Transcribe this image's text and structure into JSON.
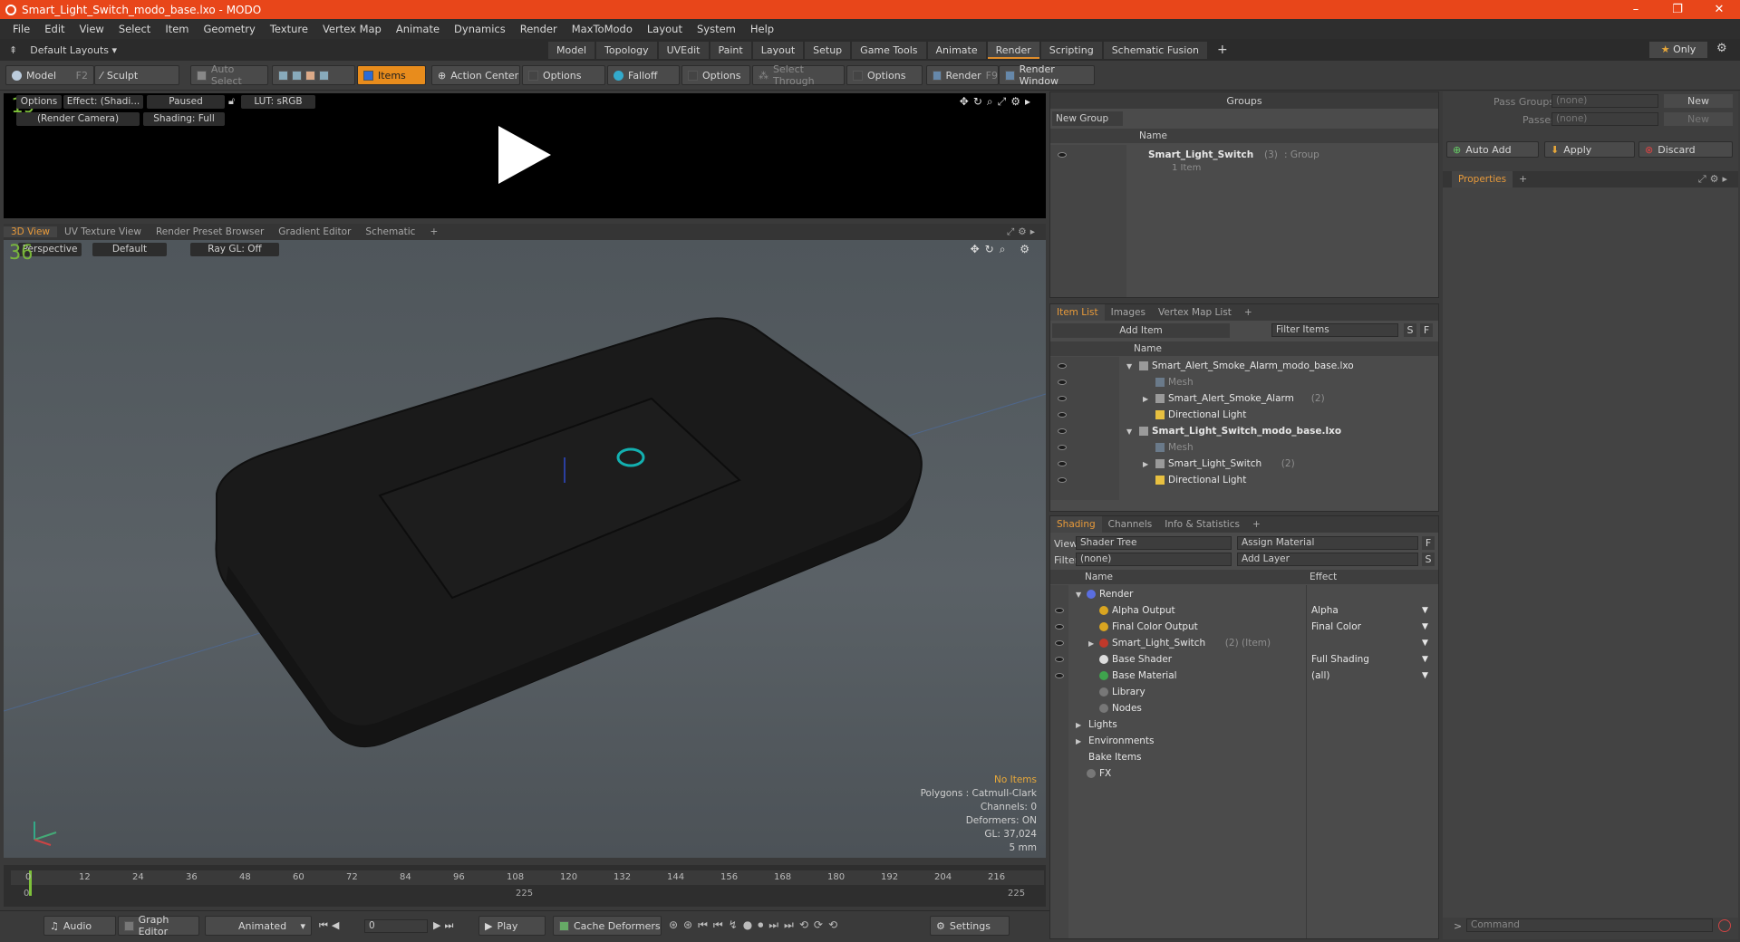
{
  "window": {
    "title": "Smart_Light_Switch_modo_base.lxo - MODO",
    "minimize": "–",
    "maximize": "❐",
    "close": "✕"
  },
  "menu": [
    "File",
    "Edit",
    "View",
    "Select",
    "Item",
    "Geometry",
    "Texture",
    "Vertex Map",
    "Animate",
    "Dynamics",
    "Render",
    "MaxToModo",
    "Layout",
    "System",
    "Help"
  ],
  "layout": {
    "label": "Default Layouts",
    "tabs": [
      "Model",
      "Topology",
      "UVEdit",
      "Paint",
      "Layout",
      "Setup",
      "Game Tools",
      "Animate",
      "Render",
      "Scripting",
      "Schematic Fusion"
    ],
    "active_tab": "Render",
    "add": "+",
    "only": "Only"
  },
  "toolbar": {
    "model": "Model",
    "model_key": "F2",
    "sculpt": "Sculpt",
    "auto_select": "Auto Select",
    "items": "Items",
    "action_center": "Action Center",
    "options1": "Options",
    "falloff": "Falloff",
    "options2": "Options",
    "select_through": "Select Through",
    "options3": "Options",
    "render": "Render",
    "render_key": "F9",
    "render_window": "Render Window"
  },
  "render_view": {
    "options": "Options",
    "effect": "Effect: (Shadi...",
    "paused": "Paused",
    "lut": "LUT: sRGB",
    "camera": "(Render Camera)",
    "shading": "Shading: Full",
    "frame": "19"
  },
  "viewport_tabs": [
    "3D View",
    "UV Texture View",
    "Render Preset Browser",
    "Gradient Editor",
    "Schematic"
  ],
  "viewport": {
    "perspective": "Perspective",
    "default": "Default",
    "raygl": "Ray GL: Off",
    "frame": "36",
    "hud": {
      "no_items": "No Items",
      "polygons": "Polygons : Catmull-Clark",
      "channels": "Channels: 0",
      "deformers": "Deformers: ON",
      "gl": "GL: 37,024",
      "scale": "5 mm"
    }
  },
  "timeline": {
    "ticks": [
      "0",
      "12",
      "24",
      "36",
      "48",
      "60",
      "72",
      "84",
      "96",
      "108",
      "120",
      "132",
      "144",
      "156",
      "168",
      "180",
      "192",
      "204",
      "216"
    ],
    "start": "0",
    "mid": "225",
    "end": "225",
    "current": "0"
  },
  "bottom": {
    "audio": "Audio",
    "graph_editor": "Graph Editor",
    "animated": "Animated",
    "frame": "0",
    "play": "Play",
    "cache": "Cache Deformers",
    "settings": "Settings"
  },
  "groups": {
    "title": "Groups",
    "new_group": "New Group",
    "col_name": "Name",
    "item_name": "Smart_Light_Switch",
    "item_count": "(3)",
    "item_type": ": Group",
    "item_sub": "1 Item"
  },
  "item_list": {
    "tabs": [
      "Item List",
      "Images",
      "Vertex Map List"
    ],
    "add_item": "Add Item",
    "filter": "Filter Items",
    "s": "S",
    "f": "F",
    "col_name": "Name",
    "rows": [
      {
        "label": "Smart_Alert_Smoke_Alarm_modo_base.lxo",
        "indent": 0,
        "bold": false,
        "dim": false,
        "chev": "▼"
      },
      {
        "label": "Mesh",
        "indent": 1,
        "bold": false,
        "dim": true,
        "chev": ""
      },
      {
        "label": "Smart_Alert_Smoke_Alarm",
        "count": "(2)",
        "indent": 1,
        "bold": false,
        "dim": false,
        "chev": "▶"
      },
      {
        "label": "Directional Light",
        "indent": 1,
        "bold": false,
        "dim": false,
        "chev": ""
      },
      {
        "label": "Smart_Light_Switch_modo_base.lxo",
        "indent": 0,
        "bold": true,
        "dim": false,
        "chev": "▼"
      },
      {
        "label": "Mesh",
        "indent": 1,
        "bold": false,
        "dim": true,
        "chev": ""
      },
      {
        "label": "Smart_Light_Switch",
        "count": "(2)",
        "indent": 1,
        "bold": false,
        "dim": false,
        "chev": "▶"
      },
      {
        "label": "Directional Light",
        "indent": 1,
        "bold": false,
        "dim": false,
        "chev": ""
      }
    ]
  },
  "shading": {
    "tabs": [
      "Shading",
      "Channels",
      "Info & Statistics"
    ],
    "view_label": "View",
    "view_value": "Shader Tree",
    "assign": "Assign Material",
    "filter_label": "Filter",
    "filter_value": "(none)",
    "add_layer": "Add Layer",
    "f": "F",
    "s": "S",
    "col_name": "Name",
    "col_effect": "Effect",
    "rows": [
      {
        "label": "Render",
        "effect": "",
        "indent": 0,
        "chev": "▼",
        "icon": "#5a6ee0"
      },
      {
        "label": "Alpha Output",
        "effect": "Alpha",
        "indent": 1,
        "chev": "",
        "icon": "#d9a521"
      },
      {
        "label": "Final Color Output",
        "effect": "Final Color",
        "indent": 1,
        "chev": "",
        "icon": "#d9a521"
      },
      {
        "label": "Smart_Light_Switch",
        "extra": "(2) (Item)",
        "effect": "",
        "indent": 1,
        "chev": "▶",
        "icon": "#c0392b"
      },
      {
        "label": "Base Shader",
        "effect": "Full Shading",
        "indent": 1,
        "chev": "",
        "icon": "#dddddd"
      },
      {
        "label": "Base Material",
        "effect": "(all)",
        "indent": 1,
        "chev": "",
        "icon": "#3fa34d"
      },
      {
        "label": "Library",
        "effect": "",
        "indent": 1,
        "chev": "",
        "icon": "#777777"
      },
      {
        "label": "Nodes",
        "effect": "",
        "indent": 1,
        "chev": "",
        "icon": "#777777"
      },
      {
        "label": "Lights",
        "effect": "",
        "indent": 0,
        "chev": "▶",
        "icon": ""
      },
      {
        "label": "Environments",
        "effect": "",
        "indent": 0,
        "chev": "▶",
        "icon": ""
      },
      {
        "label": "Bake Items",
        "effect": "",
        "indent": 0,
        "chev": "",
        "icon": ""
      },
      {
        "label": "FX",
        "effect": "",
        "indent": 0,
        "chev": "",
        "icon": "#777777"
      }
    ]
  },
  "pass": {
    "pass_groups": "Pass Groups",
    "passes": "Passes",
    "none": "(none)",
    "new": "New",
    "auto_add": "Auto Add",
    "apply": "Apply",
    "discard": "Discard",
    "properties": "Properties",
    "command": "Command"
  }
}
